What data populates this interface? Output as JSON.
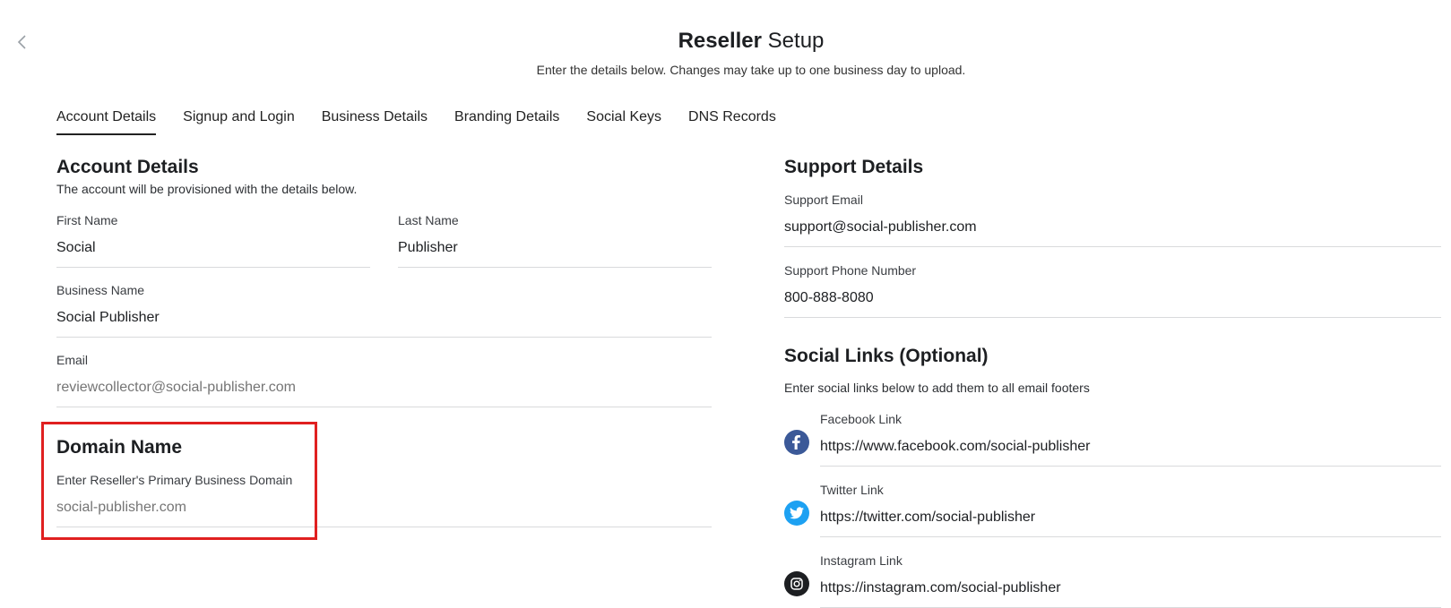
{
  "header": {
    "title_bold": "Reseller",
    "title_rest": "Setup",
    "subtitle": "Enter the details below. Changes may take up to one business day to upload."
  },
  "tabs": [
    {
      "label": "Account Details",
      "active": true
    },
    {
      "label": "Signup and Login"
    },
    {
      "label": "Business Details"
    },
    {
      "label": "Branding Details"
    },
    {
      "label": "Social Keys"
    },
    {
      "label": "DNS Records"
    }
  ],
  "account": {
    "heading": "Account Details",
    "description": "The account will be provisioned with the details below.",
    "first_name": {
      "label": "First Name",
      "value": "Social"
    },
    "last_name": {
      "label": "Last Name",
      "value": "Publisher"
    },
    "business_name": {
      "label": "Business Name",
      "value": "Social Publisher"
    },
    "email": {
      "label": "Email",
      "placeholder": "reviewcollector@social-publisher.com"
    }
  },
  "domain": {
    "heading": "Domain Name",
    "label": "Enter Reseller's Primary Business Domain",
    "placeholder": "social-publisher.com"
  },
  "support": {
    "heading": "Support Details",
    "email": {
      "label": "Support Email",
      "value": "support@social-publisher.com"
    },
    "phone": {
      "label": "Support Phone Number",
      "value": "800-888-8080"
    }
  },
  "social": {
    "heading": "Social Links (Optional)",
    "description": "Enter social links below to add them to all email footers",
    "links": [
      {
        "label": "Facebook Link",
        "value": "https://www.facebook.com/social-publisher",
        "icon": "facebook-icon",
        "color": "#3b5998"
      },
      {
        "label": "Twitter Link",
        "value": "https://twitter.com/social-publisher",
        "icon": "twitter-icon",
        "color": "#1da1f2"
      },
      {
        "label": "Instagram Link",
        "value": "https://instagram.com/social-publisher",
        "icon": "instagram-icon",
        "color": "#1d1f22"
      }
    ]
  },
  "colors": {
    "highlight": "#e02020",
    "divider": "#d9dadc"
  }
}
